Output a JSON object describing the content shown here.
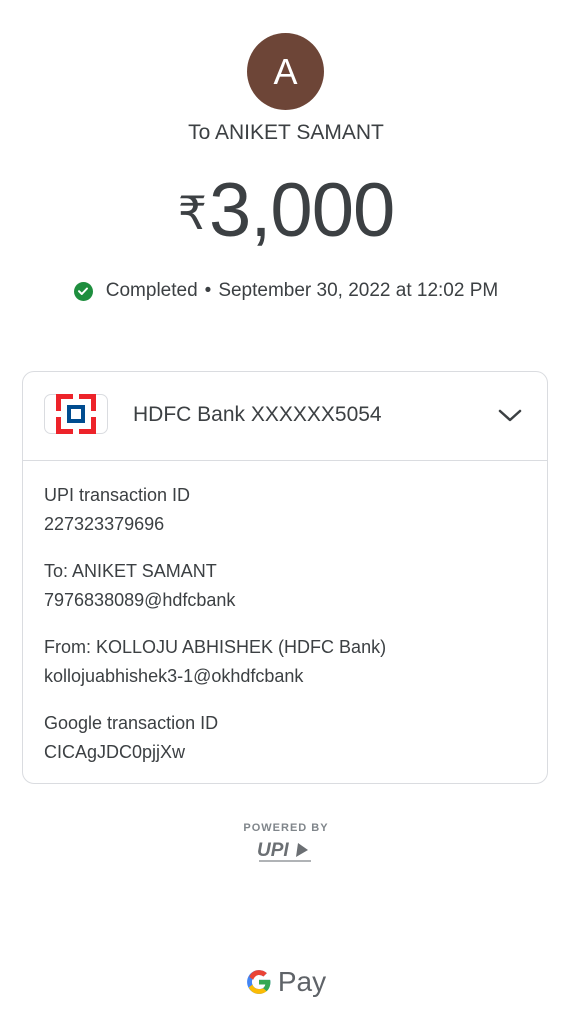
{
  "avatar": {
    "initial": "A",
    "color": "#6d4537"
  },
  "recipient_line": "To ANIKET SAMANT",
  "amount": {
    "currency": "₹",
    "value": "3,000"
  },
  "status": {
    "label": "Completed",
    "separator": "•",
    "datetime": "September 30, 2022 at 12:02 PM",
    "icon": "check-circle-icon",
    "color": "#1e8e3e"
  },
  "account": {
    "bank_name": "HDFC Bank XXXXXX5054",
    "logo": "hdfc-bank-logo",
    "expand_icon": "chevron-down-icon"
  },
  "details": [
    {
      "label": "UPI transaction ID",
      "value": "227323379696"
    },
    {
      "label": "To: ANIKET SAMANT",
      "value": "7976838089@hdfcbank"
    },
    {
      "label": "From: KOLLOJU ABHISHEK (HDFC Bank)",
      "value": "kollojuabhishek3-1@okhdfcbank"
    },
    {
      "label": "Google transaction ID",
      "value": "CICAgJDC0pjjXw"
    }
  ],
  "footer": {
    "powered_by": "POWERED BY",
    "upi_logo_text": "UPI",
    "gpay_text": "Pay"
  }
}
